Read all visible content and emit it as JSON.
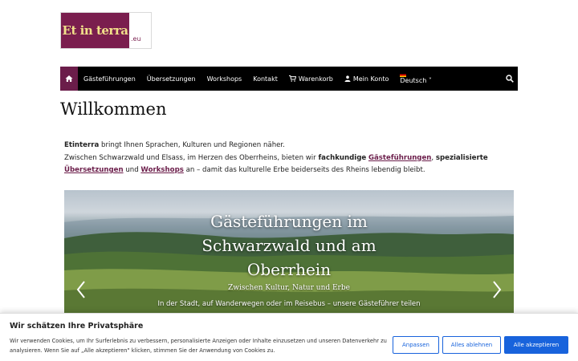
{
  "logo": {
    "mark": "Et in terra",
    "tld": ".eu"
  },
  "nav": {
    "items": [
      {
        "label": "Gästeführungen"
      },
      {
        "label": "Übersetzungen"
      },
      {
        "label": "Workshops"
      },
      {
        "label": "Kontakt"
      }
    ],
    "cart": "Warenkorb",
    "account": "Mein Konto",
    "language": "Deutsch",
    "accent_color": "#6b1d4a"
  },
  "page": {
    "title": "Willkommen"
  },
  "intro": {
    "brand": "Etinterra",
    "line1_rest": " bringt Ihnen Sprachen, Kulturen und Regionen näher.",
    "line2_pre": "Zwischen Schwarzwald und Elsass, im Herzen des Oberrheins, bieten wir ",
    "fachkundige": "fachkundige",
    "link_tours": "Gästeführungen",
    "spezialisierte": "spezialisierte",
    "link_translations": "Übersetzungen",
    "und": " und ",
    "link_workshops": "Workshops",
    "line3_post": " an – damit das kulturelle Erbe beiderseits des Rheins lebendig bleibt."
  },
  "hero": {
    "title_line1": "Gästeführungen im",
    "title_line2": "Schwarzwald und am",
    "title_line3": "Oberrhein",
    "subtitle": "Zwischen Kultur, Natur und Erbe",
    "tagline": "In der Stadt, auf Wanderwegen oder im Reisebus – unsere Gästeführer teilen"
  },
  "cookie": {
    "title": "Wir schätzen Ihre Privatsphäre",
    "text": "Wir verwenden Cookies, um Ihr Surferlebnis zu verbessern, personalisierte Anzeigen oder Inhalte einzusetzen und unseren Datenverkehr zu analysieren. Wenn Sie auf „Alle akzeptieren\" klicken, stimmen Sie der Anwendung von Cookies zu.",
    "customize": "Anpassen",
    "reject": "Alles ablehnen",
    "accept": "Alle akzeptieren",
    "button_color": "#1863dc"
  }
}
